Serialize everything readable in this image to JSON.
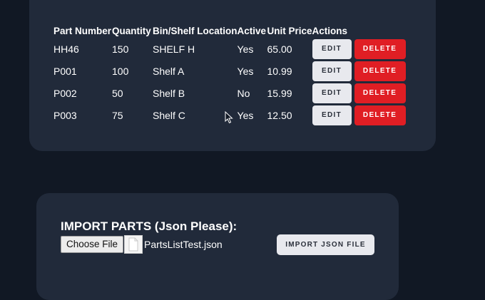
{
  "table": {
    "headers": {
      "part_number": "Part Number",
      "quantity": "Quantity",
      "location": "Bin/Shelf Location",
      "active": "Active",
      "unit_price": "Unit Price",
      "actions": "Actions"
    },
    "rows": [
      {
        "part_number": "HH46",
        "quantity": "150",
        "location": "SHELF H",
        "active": "Yes",
        "unit_price": "65.00",
        "edit": "EDIT",
        "delete": "DELETE"
      },
      {
        "part_number": "P001",
        "quantity": "100",
        "location": "Shelf A",
        "active": "Yes",
        "unit_price": "10.99",
        "edit": "EDIT",
        "delete": "DELETE"
      },
      {
        "part_number": "P002",
        "quantity": "50",
        "location": "Shelf B",
        "active": "No",
        "unit_price": "15.99",
        "edit": "EDIT",
        "delete": "DELETE"
      },
      {
        "part_number": "P003",
        "quantity": "75",
        "location": "Shelf C",
        "active": "Yes",
        "unit_price": "12.50",
        "edit": "EDIT",
        "delete": "DELETE"
      }
    ]
  },
  "import": {
    "title": "IMPORT PARTS (Json Please):",
    "choose_file": "Choose File",
    "file_name": "PartsListTest.json",
    "import_button": "IMPORT JSON FILE"
  },
  "colors": {
    "background": "#111824",
    "panel": "#212a3a",
    "delete": "#e01e24",
    "edit": "#e8e9ee"
  },
  "icons": [
    "file-icon",
    "mouse-cursor-icon"
  ]
}
